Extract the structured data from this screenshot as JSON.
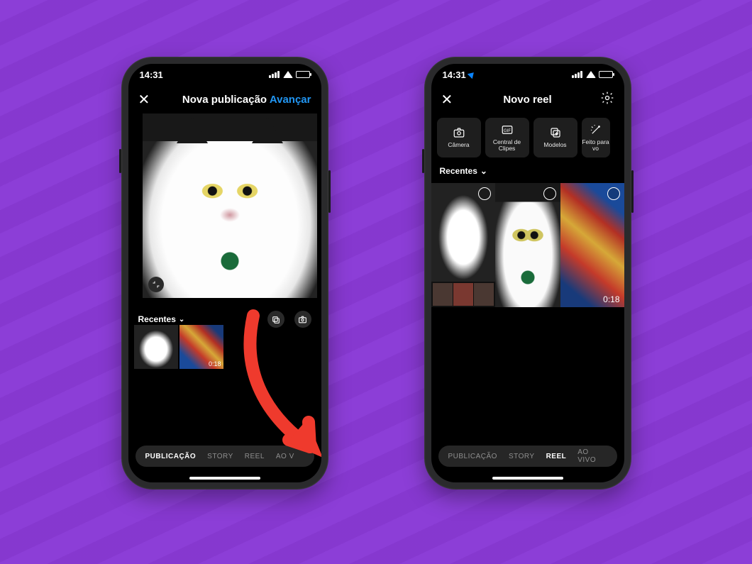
{
  "colors": {
    "background": "#8a3ad6",
    "accent_link": "#2196f3",
    "arrow": "#ef3a2d"
  },
  "statusbar": {
    "time": "14:31"
  },
  "phone1": {
    "header": {
      "title": "Nova publicação",
      "next": "Avançar"
    },
    "crop_icon": "aspect-ratio-icon",
    "gallery": {
      "dropdown_label": "Recentes",
      "thumbs": [
        {
          "kind": "photo"
        },
        {
          "kind": "video",
          "duration": "0:18"
        }
      ]
    },
    "modes": {
      "items": [
        "PUBLICAÇÃO",
        "STORY",
        "REEL",
        "AO V"
      ],
      "active_index": 0
    }
  },
  "phone2": {
    "header": {
      "title": "Novo reel"
    },
    "tiles": [
      {
        "icon": "camera-icon",
        "label": "Câmera"
      },
      {
        "icon": "gif-icon",
        "label": "Central de Clipes"
      },
      {
        "icon": "templates-icon",
        "label": "Modelos"
      },
      {
        "icon": "effects-icon",
        "label": "Feito para vo"
      }
    ],
    "gallery": {
      "dropdown_label": "Recentes",
      "video_duration": "0:18"
    },
    "modes": {
      "items": [
        "PUBLICAÇÃO",
        "STORY",
        "REEL",
        "AO VIVO"
      ],
      "active_index": 2
    }
  }
}
